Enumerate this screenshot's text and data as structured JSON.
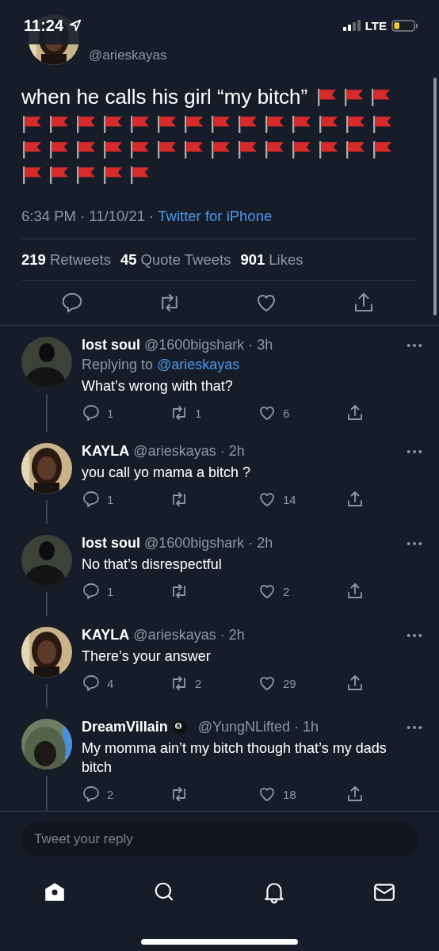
{
  "status_bar": {
    "time": "11:24",
    "network": "LTE"
  },
  "tweet": {
    "handle": "@arieskayas",
    "text": "when he calls his girl “my bitch”",
    "emoji": [
      {
        "kind": "red_flag"
      },
      {
        "kind": "red_flag"
      },
      {
        "kind": "red_flag"
      },
      {
        "kind": "red_flag"
      },
      {
        "kind": "red_flag"
      },
      {
        "kind": "red_flag"
      },
      {
        "kind": "red_flag"
      },
      {
        "kind": "red_flag"
      },
      {
        "kind": "red_flag"
      },
      {
        "kind": "red_flag"
      },
      {
        "kind": "red_flag"
      },
      {
        "kind": "red_flag"
      },
      {
        "kind": "red_flag"
      },
      {
        "kind": "red_flag"
      },
      {
        "kind": "red_flag"
      },
      {
        "kind": "red_flag"
      },
      {
        "kind": "red_flag"
      },
      {
        "kind": "red_flag"
      },
      {
        "kind": "red_flag"
      },
      {
        "kind": "red_flag"
      },
      {
        "kind": "red_flag"
      },
      {
        "kind": "red_flag"
      },
      {
        "kind": "red_flag"
      },
      {
        "kind": "red_flag"
      },
      {
        "kind": "red_flag"
      },
      {
        "kind": "red_flag"
      },
      {
        "kind": "red_flag"
      },
      {
        "kind": "red_flag"
      },
      {
        "kind": "red_flag"
      },
      {
        "kind": "red_flag"
      },
      {
        "kind": "red_flag"
      },
      {
        "kind": "red_flag"
      },
      {
        "kind": "red_flag"
      },
      {
        "kind": "red_flag"
      },
      {
        "kind": "red_flag"
      },
      {
        "kind": "red_flag"
      }
    ],
    "time": "6:34 PM · 11/10/21 ·",
    "source": "Twitter for iPhone",
    "stats": [
      {
        "count": "219",
        "label": "Retweets"
      },
      {
        "count": "45",
        "label": "Quote Tweets"
      },
      {
        "count": "901",
        "label": "Likes"
      }
    ]
  },
  "replies": [
    {
      "name": "lost soul",
      "handle": "@1600bigshark · 3h",
      "replying_prefix": "Replying to",
      "replying_to": "@arieskayas",
      "text": "What’s wrong with that?",
      "reply_count": "1",
      "retweet_count": "1",
      "like_count": "6"
    },
    {
      "name": "KAYLA",
      "handle": "@arieskayas · 2h",
      "text": "you call yo mama a bitch ?",
      "reply_count": "1",
      "like_count": "14"
    },
    {
      "name": "lost soul",
      "handle": "@1600bigshark · 2h",
      "text": "No that’s disrespectful",
      "reply_count": "1",
      "like_count": "2"
    },
    {
      "name": "KAYLA",
      "handle": "@arieskayas · 2h",
      "text": "There’s your answer",
      "reply_count": "4",
      "retweet_count": "2",
      "like_count": "29"
    },
    {
      "name": "DreamVillain",
      "emoji_badge": true,
      "handle": "@YungNLifted · 1h",
      "text": "My momma ain’t my bitch though that’s my dads bitch",
      "reply_count": "2",
      "like_count": "18"
    }
  ],
  "composer": {
    "placeholder": "Tweet your reply"
  },
  "tab_bar": [
    {
      "kind": "home",
      "selected": true
    },
    {
      "kind": "search",
      "selected": false
    },
    {
      "kind": "notifications",
      "selected": false
    },
    {
      "kind": "messages",
      "selected": false
    }
  ]
}
